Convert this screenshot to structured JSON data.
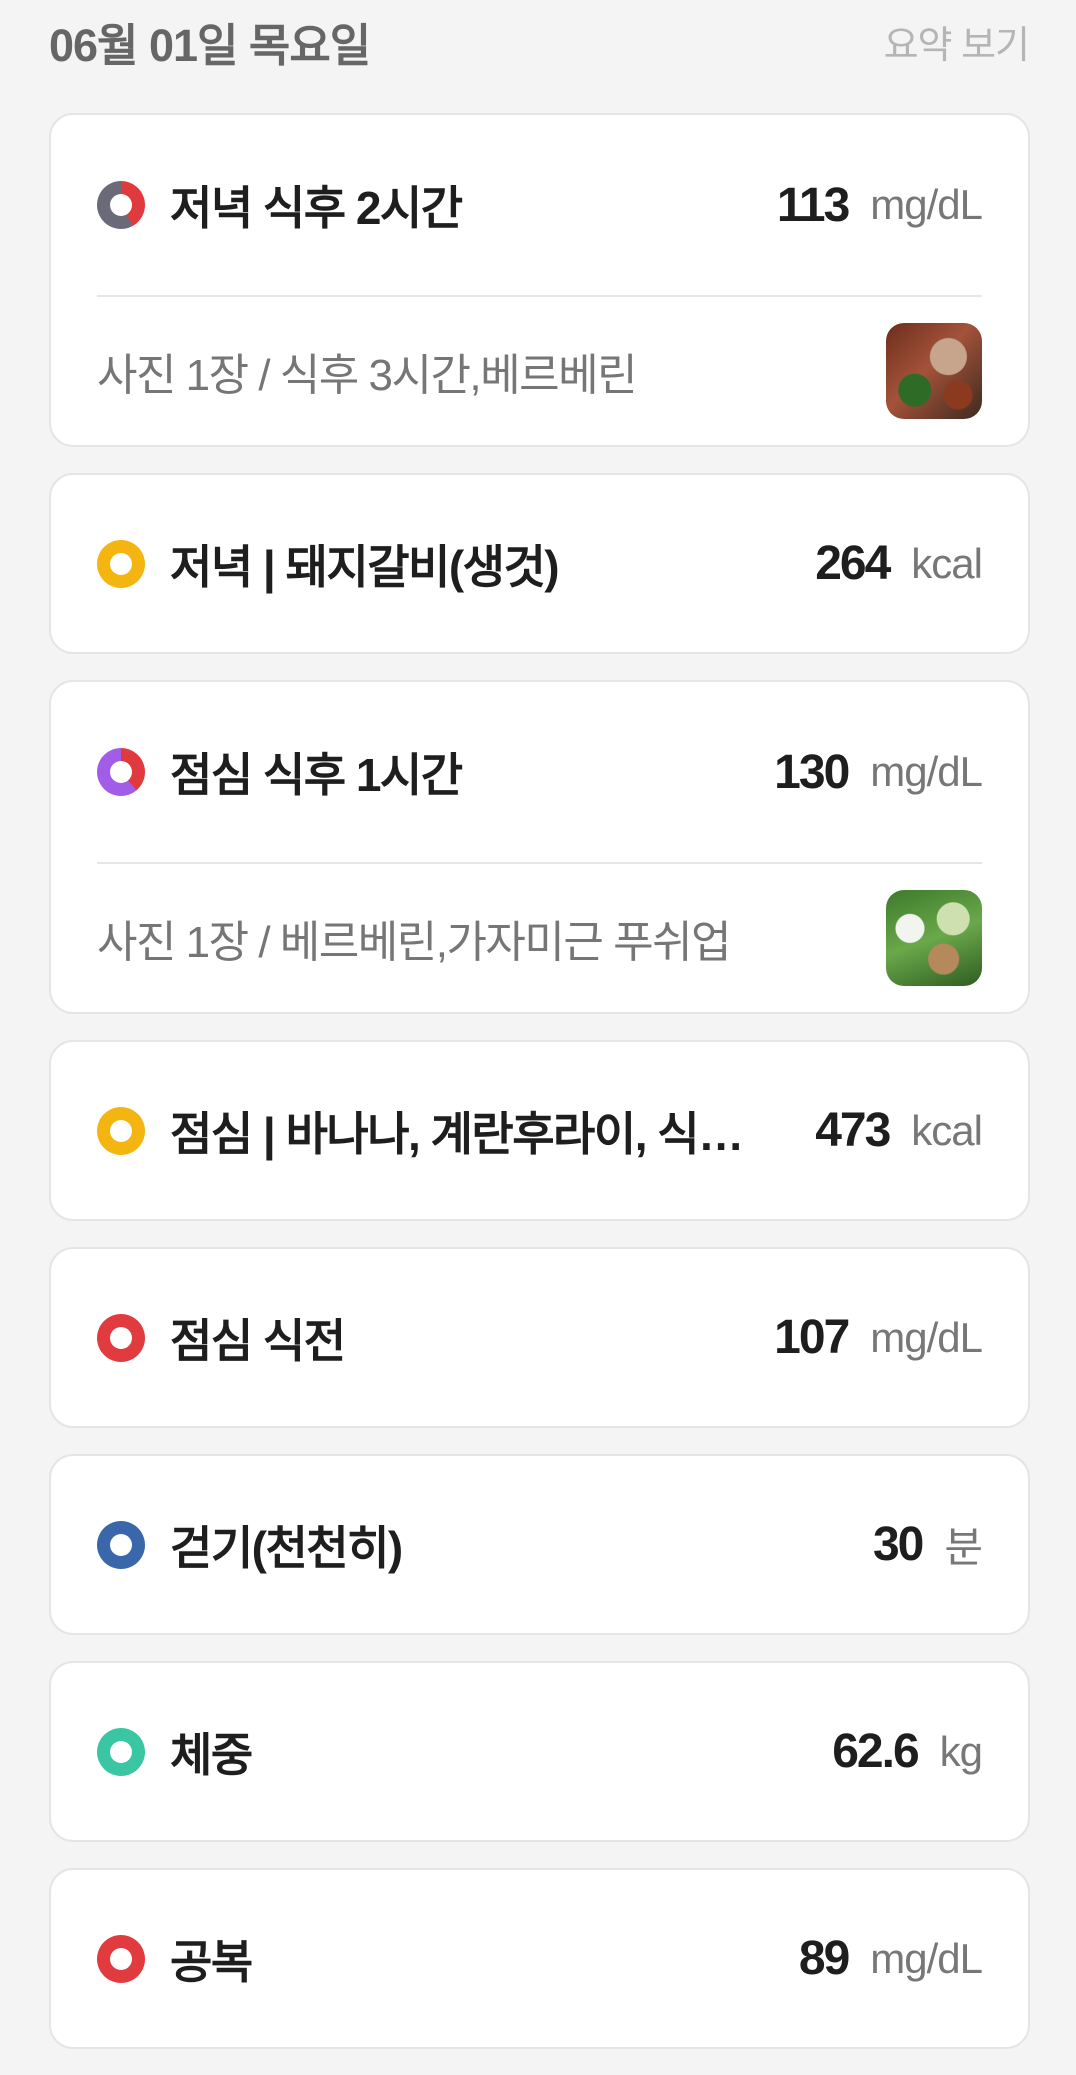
{
  "header": {
    "date": "06월 01일 목요일",
    "summary_link": "요약 보기"
  },
  "entries": [
    {
      "title": "저녁 식후 2시간",
      "value": "113",
      "unit": "mg/dL",
      "indicator": "red-gray-ring",
      "sub": "사진 1장 / 식후 3시간,베르베린",
      "photo": "dinner-meal-photo"
    },
    {
      "title": "저녁 | 돼지갈비(생것)",
      "value": "264",
      "unit": "kcal",
      "indicator": "yellow-ring"
    },
    {
      "title": "점심 식후 1시간",
      "value": "130",
      "unit": "mg/dL",
      "indicator": "red-purple-ring",
      "sub": "사진 1장 / 베르베린,가자미근 푸쉬업",
      "photo": "lunch-meal-photo"
    },
    {
      "title": "점심 | 바나나, 계란후라이, 식…",
      "value": "473",
      "unit": "kcal",
      "indicator": "yellow-ring"
    },
    {
      "title": "점심 식전",
      "value": "107",
      "unit": "mg/dL",
      "indicator": "red-ring"
    },
    {
      "title": "걷기(천천히)",
      "value": "30",
      "unit": "분",
      "indicator": "blue-ring"
    },
    {
      "title": "체중",
      "value": "62.6",
      "unit": "kg",
      "indicator": "teal-ring"
    },
    {
      "title": "공복",
      "value": "89",
      "unit": "mg/dL",
      "indicator": "red-ring"
    }
  ],
  "colors": {
    "red": "#e13b3f",
    "yellow": "#f4b510",
    "blue": "#3a66aa",
    "teal": "#3ac6a3",
    "purple": "#a15ce8",
    "gray": "#6a6a78"
  }
}
